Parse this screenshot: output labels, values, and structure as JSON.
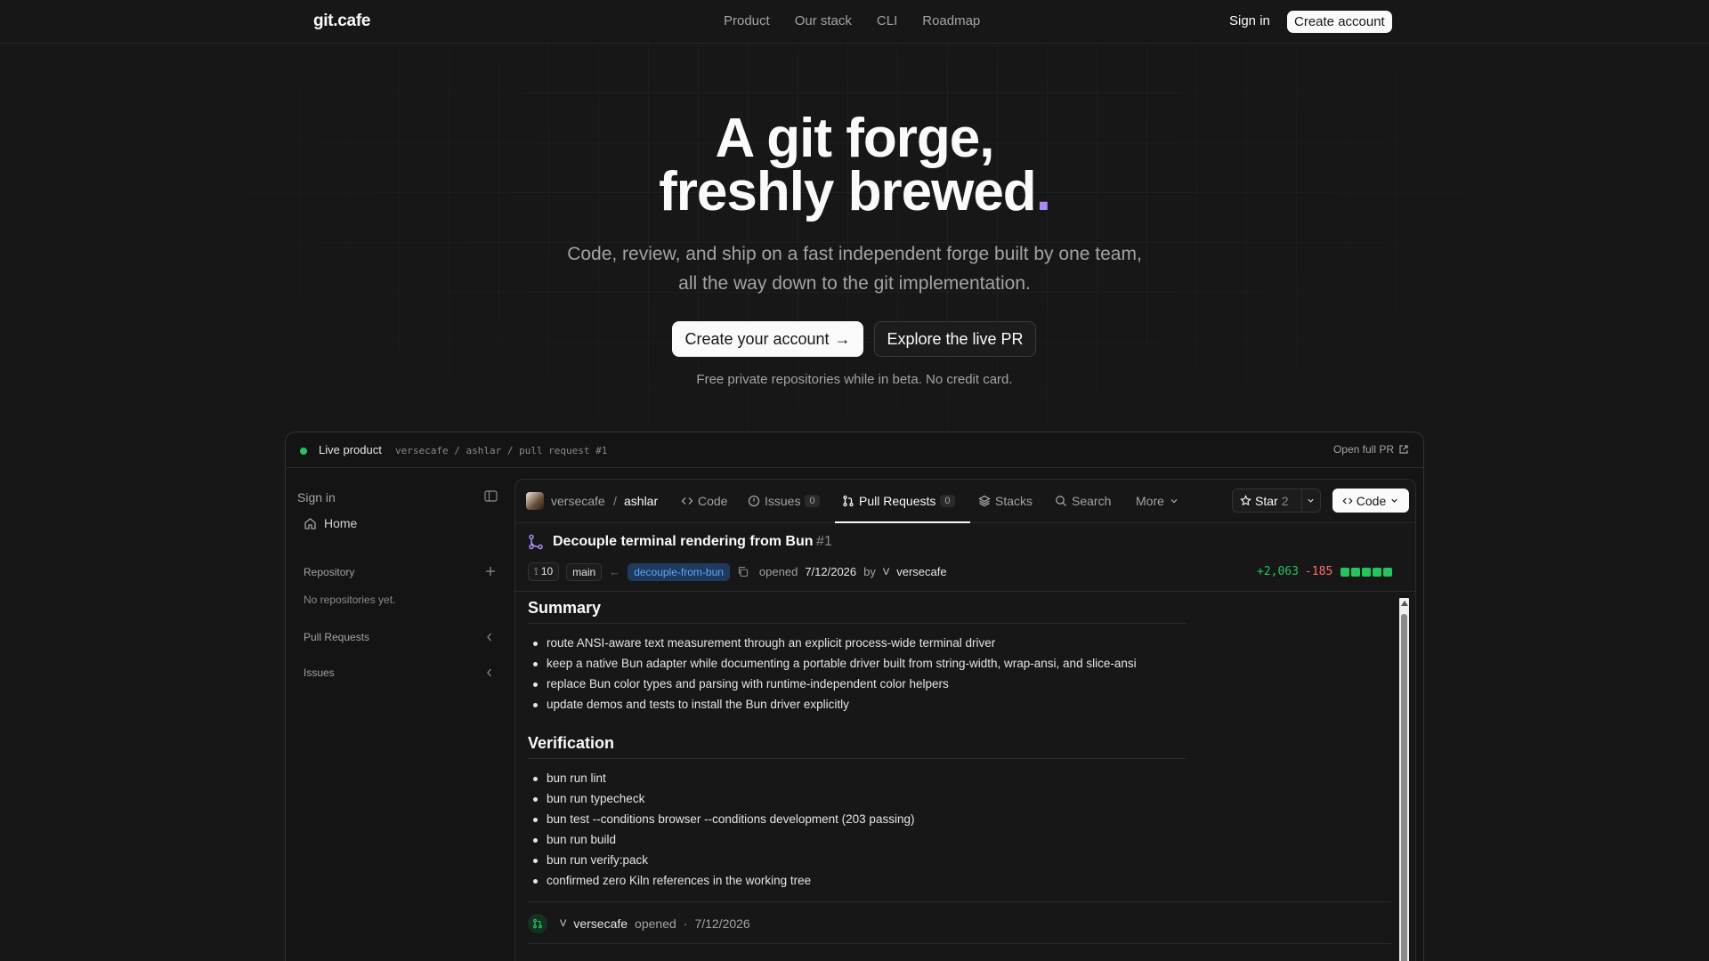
{
  "nav": {
    "logo": "git.cafe",
    "links": [
      "Product",
      "Our stack",
      "CLI",
      "Roadmap"
    ],
    "sign_in": "Sign in",
    "create_account": "Create account"
  },
  "hero": {
    "title_line1": "A git forge,",
    "title_line2": "freshly brewed",
    "title_dot": ".",
    "subtitle": "Code, review, and ship on a fast independent forge built by one team, all the way down to the git implementation.",
    "cta_primary": "Create your account",
    "cta_arrow": "→",
    "cta_secondary": "Explore the live PR",
    "fine_print": "Free private repositories while in beta. No credit card."
  },
  "frame": {
    "live_label": "Live product",
    "breadcrumb": "versecafe / ashlar / pull request #1",
    "open_full": "Open full PR"
  },
  "sidebar": {
    "sign_in": "Sign in",
    "home": "Home",
    "repository": "Repository",
    "no_repos": "No repositories yet.",
    "pull_requests": "Pull Requests",
    "issues": "Issues"
  },
  "repo": {
    "owner": "versecafe",
    "slash": "/",
    "name": "ashlar",
    "tabs": {
      "code": "Code",
      "issues": "Issues",
      "issues_count": "0",
      "pulls": "Pull Requests",
      "pulls_count": "0",
      "stacks": "Stacks",
      "search": "Search",
      "more": "More"
    },
    "star_label": "Star",
    "star_count": "2",
    "code_button": "Code"
  },
  "pr": {
    "title": "Decouple terminal rendering from Bun",
    "number": "#1",
    "commits": "10",
    "base": "main",
    "head": "decouple-from-bun",
    "opened_label": "opened",
    "opened_date": "7/12/2026",
    "by": "by",
    "author_initial": "V",
    "author": "versecafe",
    "additions": "+2,063",
    "deletions": "-185"
  },
  "body": {
    "summary_heading": "Summary",
    "summary_items": [
      "route ANSI-aware text measurement through an explicit process-wide terminal driver",
      "keep a native Bun adapter while documenting a portable driver built from string-width, wrap-ansi, and slice-ansi",
      "replace Bun color types and parsing with runtime-independent color helpers",
      "update demos and tests to install the Bun driver explicitly"
    ],
    "verification_heading": "Verification",
    "verification_items": [
      "bun run lint",
      "bun run typecheck",
      "bun test --conditions browser --conditions development (203 passing)",
      "bun run build",
      "bun run verify:pack",
      "confirmed zero Kiln references in the working tree"
    ]
  },
  "timeline": {
    "initial": "V",
    "user": "versecafe",
    "action": "opened",
    "sep": "·",
    "date": "7/12/2026"
  },
  "colors": {
    "accent_purple": "#a78bfa",
    "addition_green": "#22c55e",
    "deletion_red": "#f87171",
    "branch_blue": "#60a5fa"
  }
}
